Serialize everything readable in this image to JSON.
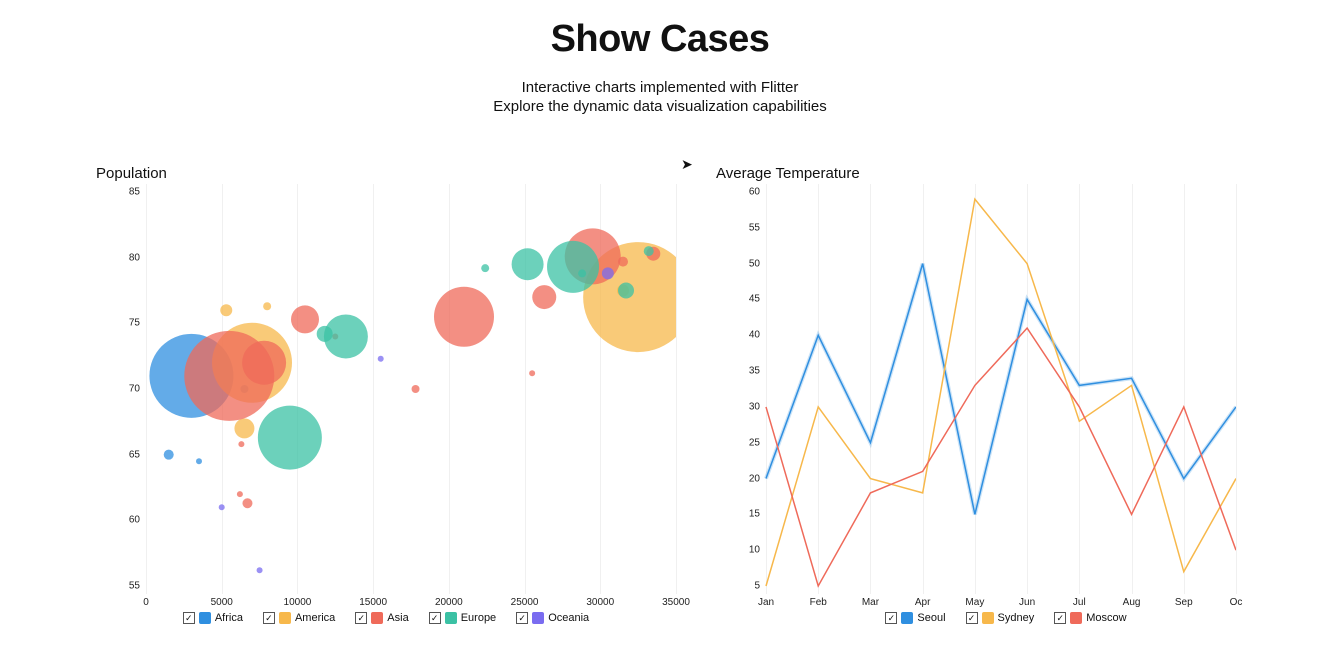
{
  "header": {
    "title": "Show Cases",
    "subtitle1": "Interactive charts implemented with Flitter",
    "subtitle2": "Explore the dynamic data visualization capabilities"
  },
  "chart_data": [
    {
      "type": "scatter",
      "title": "Population",
      "xlim": [
        0,
        35000
      ],
      "ylim": [
        55,
        85
      ],
      "x_ticks": [
        0,
        5000,
        10000,
        15000,
        20000,
        25000,
        30000,
        35000
      ],
      "y_ticks": [
        55,
        60,
        65,
        70,
        75,
        80,
        85
      ],
      "legend": [
        "Africa",
        "America",
        "Asia",
        "Europe",
        "Oceania"
      ],
      "colors": {
        "Africa": "#2f8fe0",
        "America": "#f7b84b",
        "Asia": "#ef6a5a",
        "Europe": "#3bc1a4",
        "Oceania": "#7a6cf0"
      },
      "series": [
        {
          "name": "Africa",
          "points": [
            {
              "x": 3000,
              "y": 71,
              "r": 42
            },
            {
              "x": 1500,
              "y": 65,
              "r": 5
            },
            {
              "x": 6500,
              "y": 70,
              "r": 4
            },
            {
              "x": 3500,
              "y": 64.5,
              "r": 3
            }
          ]
        },
        {
          "name": "America",
          "points": [
            {
              "x": 7000,
              "y": 72,
              "r": 40
            },
            {
              "x": 6500,
              "y": 67,
              "r": 10
            },
            {
              "x": 32500,
              "y": 77,
              "r": 55
            },
            {
              "x": 31500,
              "y": 77.5,
              "r": 6
            },
            {
              "x": 5300,
              "y": 76,
              "r": 6
            },
            {
              "x": 8000,
              "y": 76.3,
              "r": 4
            }
          ]
        },
        {
          "name": "Asia",
          "points": [
            {
              "x": 5500,
              "y": 71,
              "r": 45
            },
            {
              "x": 10500,
              "y": 75.3,
              "r": 14
            },
            {
              "x": 7800,
              "y": 72,
              "r": 22
            },
            {
              "x": 21000,
              "y": 75.5,
              "r": 30
            },
            {
              "x": 29500,
              "y": 80.1,
              "r": 28
            },
            {
              "x": 26300,
              "y": 77,
              "r": 12
            },
            {
              "x": 33500,
              "y": 80.3,
              "r": 7
            },
            {
              "x": 12500,
              "y": 74,
              "r": 3
            },
            {
              "x": 6700,
              "y": 61.3,
              "r": 5
            },
            {
              "x": 6200,
              "y": 62,
              "r": 3
            },
            {
              "x": 6300,
              "y": 65.8,
              "r": 3
            },
            {
              "x": 31500,
              "y": 79.7,
              "r": 5
            },
            {
              "x": 17800,
              "y": 70,
              "r": 4
            },
            {
              "x": 25500,
              "y": 71.2,
              "r": 3
            }
          ]
        },
        {
          "name": "Europe",
          "points": [
            {
              "x": 9500,
              "y": 66.3,
              "r": 32
            },
            {
              "x": 13200,
              "y": 74,
              "r": 22
            },
            {
              "x": 11800,
              "y": 74.2,
              "r": 8
            },
            {
              "x": 28200,
              "y": 79.3,
              "r": 26
            },
            {
              "x": 25200,
              "y": 79.5,
              "r": 16
            },
            {
              "x": 22400,
              "y": 79.2,
              "r": 4
            },
            {
              "x": 31700,
              "y": 77.5,
              "r": 8
            },
            {
              "x": 33200,
              "y": 80.5,
              "r": 5
            },
            {
              "x": 28800,
              "y": 78.8,
              "r": 4
            }
          ]
        },
        {
          "name": "Oceania",
          "points": [
            {
              "x": 30500,
              "y": 78.8,
              "r": 6
            },
            {
              "x": 5000,
              "y": 61,
              "r": 3
            },
            {
              "x": 15500,
              "y": 72.3,
              "r": 3
            },
            {
              "x": 7500,
              "y": 56.2,
              "r": 3
            }
          ]
        }
      ]
    },
    {
      "type": "line",
      "title": "Average Temperature",
      "categories": [
        "Jan",
        "Feb",
        "Mar",
        "Apr",
        "May",
        "Jun",
        "Jul",
        "Aug",
        "Sep",
        "Oc"
      ],
      "ylim": [
        5,
        60
      ],
      "y_ticks": [
        5,
        10,
        15,
        20,
        25,
        30,
        35,
        40,
        45,
        50,
        55,
        60
      ],
      "legend": [
        "Seoul",
        "Sydney",
        "Moscow"
      ],
      "colors": {
        "Seoul": "#2f8fe0",
        "Sydney": "#f7b84b",
        "Moscow": "#ef6a5a"
      },
      "series": [
        {
          "name": "Seoul",
          "values": [
            20,
            40,
            25,
            50,
            15,
            45,
            33,
            34,
            20,
            30
          ]
        },
        {
          "name": "Sydney",
          "values": [
            5,
            30,
            20,
            18,
            59,
            50,
            28,
            33,
            7,
            20
          ]
        },
        {
          "name": "Moscow",
          "values": [
            30,
            5,
            18,
            21,
            33,
            41,
            30,
            15,
            30,
            10
          ]
        }
      ]
    }
  ]
}
